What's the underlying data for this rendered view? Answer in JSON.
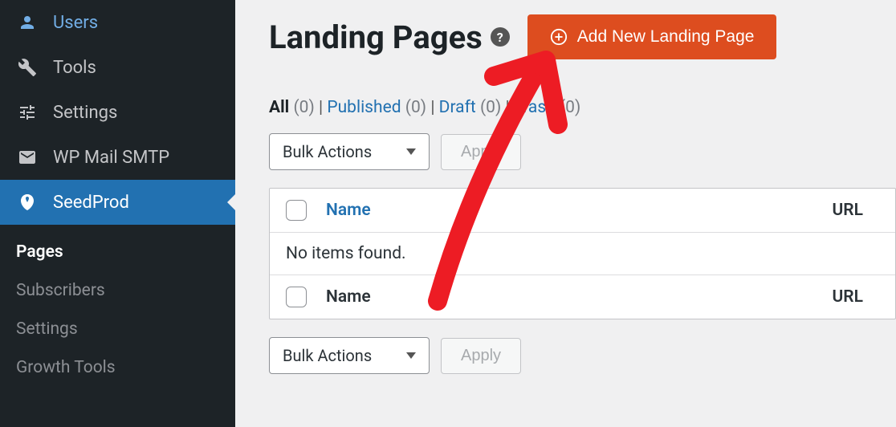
{
  "sidebar": {
    "items": [
      {
        "label": "Users"
      },
      {
        "label": "Tools"
      },
      {
        "label": "Settings"
      },
      {
        "label": "WP Mail SMTP"
      },
      {
        "label": "SeedProd"
      }
    ],
    "submenu": [
      {
        "label": "Pages"
      },
      {
        "label": "Subscribers"
      },
      {
        "label": "Settings"
      },
      {
        "label": "Growth Tools"
      }
    ]
  },
  "header": {
    "title": "Landing Pages",
    "add_button": "Add New Landing Page"
  },
  "filters": {
    "all_label": "All",
    "all_count": "(0)",
    "published_label": "Published",
    "published_count": "(0)",
    "draft_label": "Draft",
    "draft_count": "(0)",
    "trash_label": "Trash",
    "trash_count": "(0)",
    "sep": " | "
  },
  "actions": {
    "bulk_label": "Bulk Actions",
    "apply_label": "Apply"
  },
  "table": {
    "name_header": "Name",
    "url_header": "URL",
    "empty": "No items found."
  }
}
